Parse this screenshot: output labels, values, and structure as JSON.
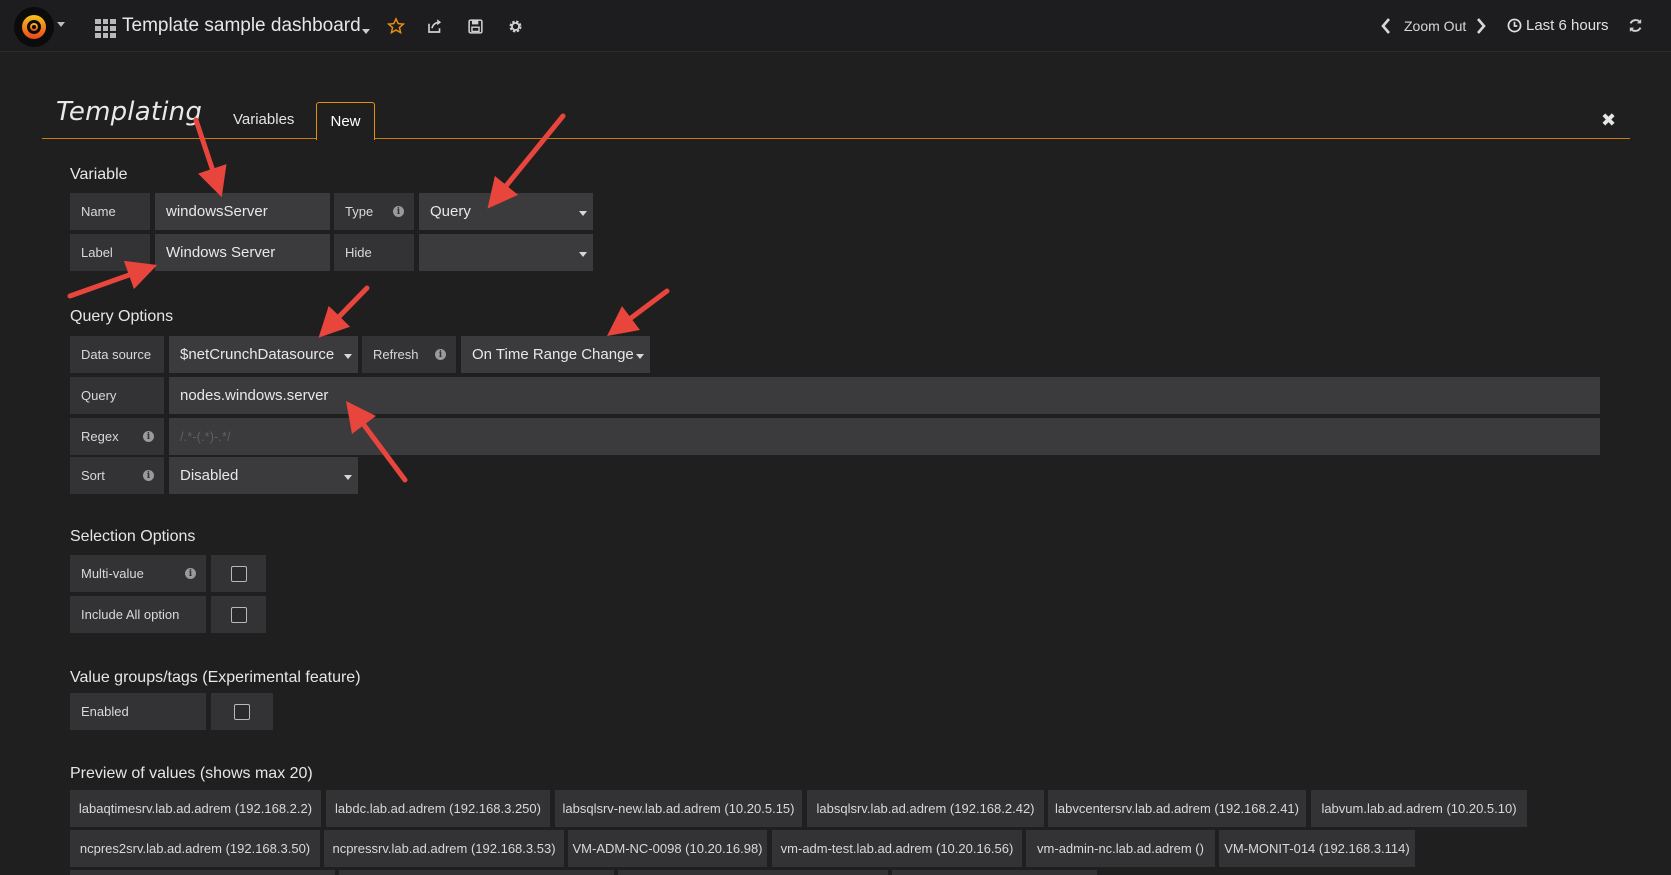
{
  "navbar": {
    "dashboard_title": "Template sample dashboard",
    "zoom_out": "Zoom Out",
    "time_range": "Last 6 hours",
    "icons": [
      "grafana-logo",
      "dashboard-grid-icon",
      "star-icon",
      "share-icon",
      "save-icon",
      "gear-icon",
      "chevron-left-icon",
      "chevron-right-icon",
      "clock-icon",
      "refresh-icon"
    ],
    "accent": "#e88d0e"
  },
  "templating": {
    "title": "Templating",
    "tabs": [
      "Variables",
      "New"
    ],
    "active_tab": "New"
  },
  "variable": {
    "section_title": "Variable",
    "name_label": "Name",
    "name_value": "windowsServer",
    "type_label": "Type",
    "type_value": "Query",
    "label_label": "Label",
    "label_value": "Windows Server",
    "hide_label": "Hide",
    "hide_value": ""
  },
  "query_options": {
    "section_title": "Query Options",
    "datasource_label": "Data source",
    "datasource_value": "$netCrunchDatasource",
    "refresh_label": "Refresh",
    "refresh_value": "On Time Range Change",
    "query_label": "Query",
    "query_value": "nodes.windows.server",
    "regex_label": "Regex",
    "regex_placeholder": "/.*-(.*)-.*/",
    "sort_label": "Sort",
    "sort_value": "Disabled"
  },
  "selection_options": {
    "section_title": "Selection Options",
    "multi_value_label": "Multi-value",
    "multi_value_checked": false,
    "include_all_label": "Include All option",
    "include_all_checked": false
  },
  "value_groups": {
    "section_title": "Value groups/tags (Experimental feature)",
    "enabled_label": "Enabled",
    "enabled_checked": false
  },
  "preview": {
    "section_title": "Preview of values (shows max 20)",
    "row1": [
      "labaqtimesrv.lab.ad.adrem (192.168.2.2)",
      "labdc.lab.ad.adrem (192.168.3.250)",
      "labsqlsrv-new.lab.ad.adrem (10.20.5.15)",
      "labsqlsrv.lab.ad.adrem (192.168.2.42)",
      "labvcentersrv.lab.ad.adrem (192.168.2.41)",
      "labvum.lab.ad.adrem (10.20.5.10)"
    ],
    "row2": [
      "ncpres2srv.lab.ad.adrem (192.168.3.50)",
      "ncpressrv.lab.ad.adrem (192.168.3.53)",
      "VM-ADM-NC-0098 (10.20.16.98)",
      "vm-adm-test.lab.ad.adrem (10.20.16.56)",
      "vm-admin-nc.lab.ad.adrem ()",
      "VM-MONIT-014 (192.168.3.114)"
    ]
  },
  "annotation_color": "#e8453c"
}
